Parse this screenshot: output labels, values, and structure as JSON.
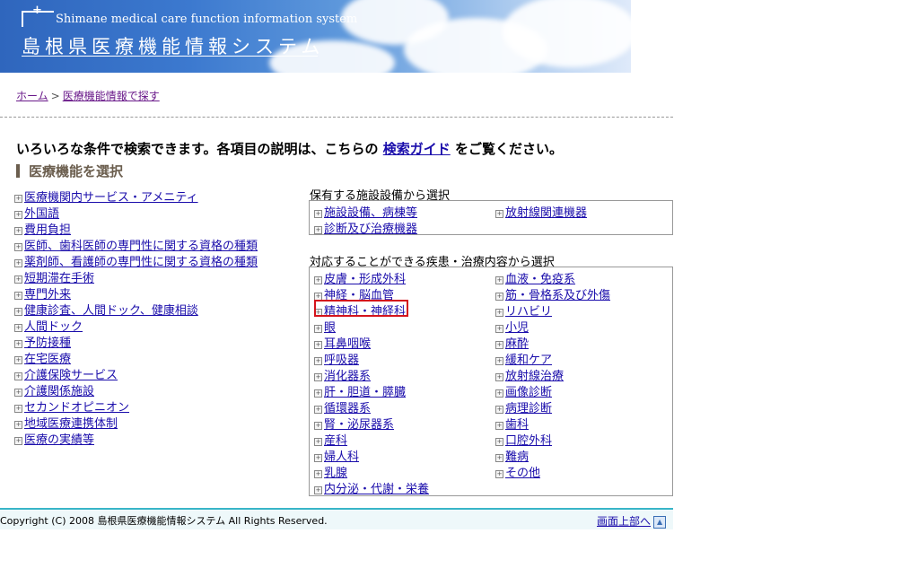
{
  "header": {
    "logo_mark": "+",
    "subtitle": "Shimane medical care function information system",
    "title": "島根県医療機能情報システム"
  },
  "breadcrumb": {
    "home": "ホーム",
    "separator": ">",
    "current": "医療機能情報で探す"
  },
  "intro": {
    "before": "いろいろな条件で検索できます。各項目の説明は、こちらの",
    "link": "検索ガイド",
    "after": "をご覧ください。"
  },
  "section_heading": "医療機能を選択",
  "plus_symbol": "+",
  "left_items": [
    "医療機関内サービス・アメニティ",
    "外国語",
    "費用負担",
    "医師、歯科医師の専門性に関する資格の種類",
    "薬剤師、看護師の専門性に関する資格の種類",
    "短期滞在手術",
    "専門外来",
    "健康診査、人間ドック、健康相談",
    "人間ドック",
    "予防接種",
    "在宅医療",
    "介護保険サービス",
    "介護関係施設",
    "セカンドオピニオン",
    "地域医療連携体制",
    "医療の実績等"
  ],
  "facility_section": {
    "label": "保有する施設設備から選択",
    "items": [
      "施設設備、病棟等",
      "放射線関連機器",
      "診断及び治療機器"
    ]
  },
  "disease_section": {
    "label": "対応することができる疾患・治療内容から選択",
    "col1": [
      "皮膚・形成外科",
      "神経・脳血管",
      "精神科・神経科",
      "眼",
      "耳鼻咽喉",
      "呼吸器",
      "消化器系",
      "肝・胆道・膵臓",
      "循環器系",
      "腎・泌尿器系",
      "産科",
      "婦人科",
      "乳腺",
      "内分泌・代謝・栄養"
    ],
    "col2": [
      "血液・免疫系",
      "筋・骨格系及び外傷",
      "リハビリ",
      "小児",
      "麻酔",
      "緩和ケア",
      "放射線治療",
      "画像診断",
      "病理診断",
      "歯科",
      "口腔外科",
      "難病",
      "その他"
    ]
  },
  "footer": {
    "copyright": "Copyright (C) 2008 島根県医療機能情報システム All Rights Reserved.",
    "to_top": "画面上部へ",
    "up_symbol": "▲"
  },
  "colors": {
    "link": "#1a0dab",
    "visited_link": "#6a1a8a",
    "highlight": "#d4141c",
    "footer_accent": "#38b5c8"
  }
}
